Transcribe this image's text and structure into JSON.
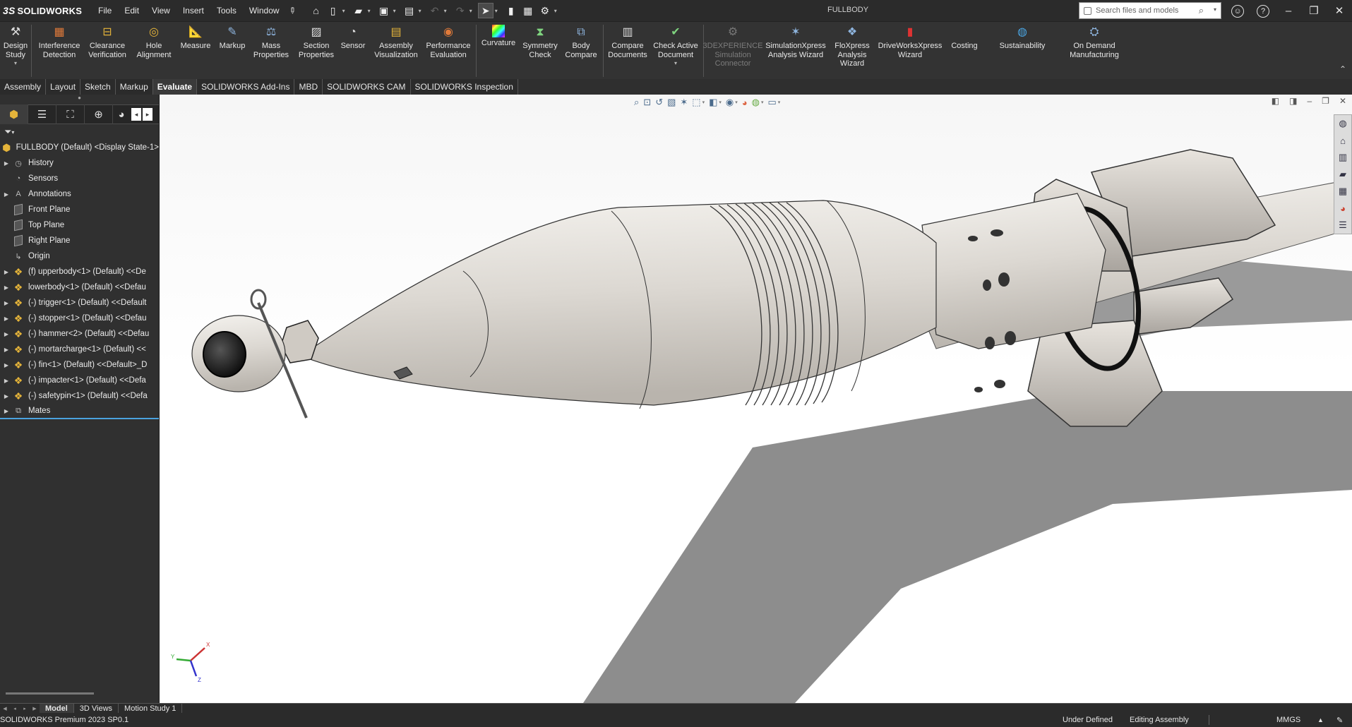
{
  "app": {
    "brand": "SOLIDWORKS",
    "brand_mark": "3S",
    "document_title": "FULLBODY"
  },
  "menu": [
    "File",
    "Edit",
    "View",
    "Insert",
    "Tools",
    "Window"
  ],
  "search": {
    "placeholder": "Search files and models"
  },
  "ribbon": {
    "design_study": "Design Study",
    "interference_detection": "Interference Detection",
    "clearance_verification": "Clearance Verification",
    "hole_alignment": "Hole Alignment",
    "measure": "Measure",
    "markup": "Markup",
    "mass_properties": "Mass Properties",
    "section_properties": "Section Properties",
    "sensor": "Sensor",
    "assembly_visualization": "Assembly Visualization",
    "performance_evaluation": "Performance Evaluation",
    "curvature": "Curvature",
    "symmetry_check": "Symmetry Check",
    "body_compare": "Body Compare",
    "compare_documents": "Compare Documents",
    "check_active_document": "Check Active Document",
    "simulation_connector": "3DEXPERIENCE Simulation Connector",
    "simulationxpress": "SimulationXpress Analysis Wizard",
    "floxpress": "FloXpress Analysis Wizard",
    "driveworksxpress": "DriveWorksXpress Wizard",
    "costing": "Costing",
    "sustainability": "Sustainability",
    "on_demand_manufacturing": "On Demand Manufacturing"
  },
  "command_tabs": [
    "Assembly",
    "Layout",
    "Sketch",
    "Markup",
    "Evaluate",
    "SOLIDWORKS Add-Ins",
    "MBD",
    "SOLIDWORKS CAM",
    "SOLIDWORKS Inspection"
  ],
  "active_command_tab": "Evaluate",
  "feature_tree": {
    "root": "FULLBODY (Default) <Display State-1>",
    "items": [
      {
        "label": "History",
        "icon": "history-icon",
        "expandable": true
      },
      {
        "label": "Sensors",
        "icon": "sensor-icon",
        "expandable": false
      },
      {
        "label": "Annotations",
        "icon": "annotation-icon",
        "expandable": true
      },
      {
        "label": "Front Plane",
        "icon": "plane-icon",
        "expandable": false
      },
      {
        "label": "Top Plane",
        "icon": "plane-icon",
        "expandable": false
      },
      {
        "label": "Right Plane",
        "icon": "plane-icon",
        "expandable": false
      },
      {
        "label": "Origin",
        "icon": "origin-icon",
        "expandable": false
      },
      {
        "label": "(f) upperbody<1> (Default) <<De",
        "icon": "part-icon",
        "expandable": true
      },
      {
        "label": "lowerbody<1> (Default) <<Defau",
        "icon": "part-icon",
        "expandable": true
      },
      {
        "label": "(-) trigger<1> (Default) <<Default",
        "icon": "part-icon",
        "expandable": true
      },
      {
        "label": "(-) stopper<1> (Default) <<Defau",
        "icon": "part-icon",
        "expandable": true
      },
      {
        "label": "(-) hammer<2> (Default) <<Defau",
        "icon": "part-icon",
        "expandable": true
      },
      {
        "label": "(-) mortarcharge<1> (Default) <<",
        "icon": "part-icon",
        "expandable": true
      },
      {
        "label": "(-) fin<1> (Default) <<Default>_D",
        "icon": "part-icon",
        "expandable": true
      },
      {
        "label": "(-) impacter<1> (Default) <<Defa",
        "icon": "part-icon",
        "expandable": true
      },
      {
        "label": "(-) safetypin<1> (Default) <<Defa",
        "icon": "part-icon",
        "expandable": true
      },
      {
        "label": "Mates",
        "icon": "mates-icon",
        "expandable": true
      }
    ]
  },
  "bottom_tabs": [
    "Model",
    "3D Views",
    "Motion Study 1"
  ],
  "active_bottom_tab": "Model",
  "status": {
    "version": "SOLIDWORKS Premium 2023 SP0.1",
    "definition": "Under Defined",
    "mode": "Editing Assembly",
    "units": "MMGS"
  },
  "triad": {
    "x": "X",
    "y": "Y",
    "z": "Z"
  },
  "colors": {
    "accent": "#4aa3df",
    "part_yellow": "#e5b43a",
    "ui_dark": "#2b2b2b",
    "model_body": "#dcd8d2"
  }
}
